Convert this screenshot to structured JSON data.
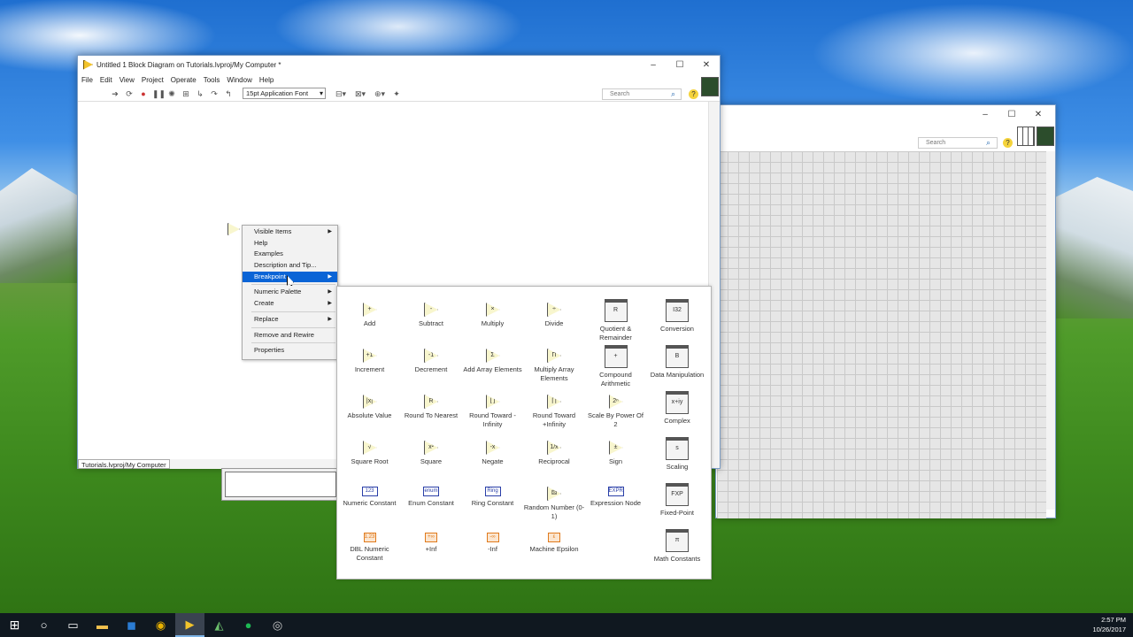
{
  "block_diagram": {
    "title": "Untitled 1 Block Diagram on Tutorials.lvproj/My Computer *",
    "menus": [
      "File",
      "Edit",
      "View",
      "Project",
      "Operate",
      "Tools",
      "Window",
      "Help"
    ],
    "font_select": "15pt Application Font",
    "search_placeholder": "Search",
    "path_label": "Tutorials.lvproj/My Computer"
  },
  "front_panel": {
    "search_placeholder": "Search"
  },
  "context_menu": {
    "items": [
      {
        "label": "Visible Items",
        "submenu": true
      },
      {
        "label": "Help",
        "submenu": false
      },
      {
        "label": "Examples",
        "submenu": false
      },
      {
        "label": "Description and Tip...",
        "submenu": false
      },
      {
        "label": "Breakpoint",
        "submenu": true,
        "highlighted": true
      },
      {
        "label": "Numeric Palette",
        "submenu": true
      },
      {
        "label": "Create",
        "submenu": true
      },
      {
        "label": "Replace",
        "submenu": true
      },
      {
        "label": "Remove and Rewire",
        "submenu": false
      },
      {
        "label": "Properties",
        "submenu": false
      }
    ]
  },
  "palette": {
    "rows": [
      [
        {
          "label": "Add",
          "glyph": "+"
        },
        {
          "label": "Subtract",
          "glyph": "-"
        },
        {
          "label": "Multiply",
          "glyph": "×"
        },
        {
          "label": "Divide",
          "glyph": "÷"
        },
        {
          "label": "Quotient & Remainder",
          "glyph": "R"
        },
        {
          "label": "Conversion",
          "glyph": "I32"
        }
      ],
      [
        {
          "label": "Increment",
          "glyph": "+1"
        },
        {
          "label": "Decrement",
          "glyph": "-1"
        },
        {
          "label": "Add Array Elements",
          "glyph": "Σ"
        },
        {
          "label": "Multiply Array Elements",
          "glyph": "Π"
        },
        {
          "label": "Compound Arithmetic",
          "glyph": "+"
        },
        {
          "label": "Data Manipulation",
          "glyph": "B"
        }
      ],
      [
        {
          "label": "Absolute Value",
          "glyph": "|x|"
        },
        {
          "label": "Round To Nearest",
          "glyph": "R"
        },
        {
          "label": "Round Toward -Infinity",
          "glyph": "⌊⌋"
        },
        {
          "label": "Round Toward +Infinity",
          "glyph": "⌈⌉"
        },
        {
          "label": "Scale By Power Of 2",
          "glyph": "2ⁿ"
        },
        {
          "label": "Complex",
          "glyph": "x+iy"
        }
      ],
      [
        {
          "label": "Square Root",
          "glyph": "√"
        },
        {
          "label": "Square",
          "glyph": "x²"
        },
        {
          "label": "Negate",
          "glyph": "-x"
        },
        {
          "label": "Reciprocal",
          "glyph": "1/x"
        },
        {
          "label": "Sign",
          "glyph": "±"
        },
        {
          "label": "Scaling",
          "glyph": "s"
        }
      ],
      [
        {
          "label": "Numeric Constant",
          "glyph": "123"
        },
        {
          "label": "Enum Constant",
          "glyph": "enum"
        },
        {
          "label": "Ring Constant",
          "glyph": "Ring"
        },
        {
          "label": "Random Number (0-1)",
          "glyph": "⚄"
        },
        {
          "label": "Expression Node",
          "glyph": "EXPR"
        },
        {
          "label": "Fixed-Point",
          "glyph": "FXP"
        }
      ],
      [
        {
          "label": "DBL Numeric Constant",
          "glyph": "1.23"
        },
        {
          "label": "+Inf",
          "glyph": "+∞"
        },
        {
          "label": "-Inf",
          "glyph": "-∞"
        },
        {
          "label": "Machine Epsilon",
          "glyph": "ε"
        },
        {
          "label": "",
          "glyph": ""
        },
        {
          "label": "Math Constants",
          "glyph": "π"
        }
      ]
    ]
  },
  "taskbar": {
    "time": "2:57 PM",
    "date": "10/26/2017"
  }
}
